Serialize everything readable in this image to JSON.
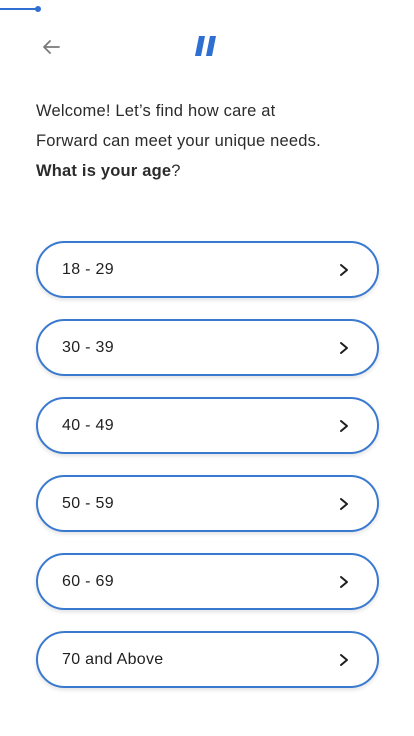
{
  "progress": {
    "value_percent": 9
  },
  "header": {
    "back_icon": "arrow-left-icon",
    "logo_icon": "forward-logo-icon",
    "accent_color": "#2f6fd1"
  },
  "intro": {
    "line1": "Welcome! Let’s find how care at",
    "line2": "Forward can meet your unique needs.",
    "question_bold": "What is your age",
    "question_mark": "?"
  },
  "age_options": [
    {
      "label": "18 - 29"
    },
    {
      "label": "30 - 39"
    },
    {
      "label": "40 - 49"
    },
    {
      "label": "50 - 59"
    },
    {
      "label": "60 - 69"
    },
    {
      "label": "70 and Above"
    }
  ],
  "option_icon": "chevron-right-icon"
}
